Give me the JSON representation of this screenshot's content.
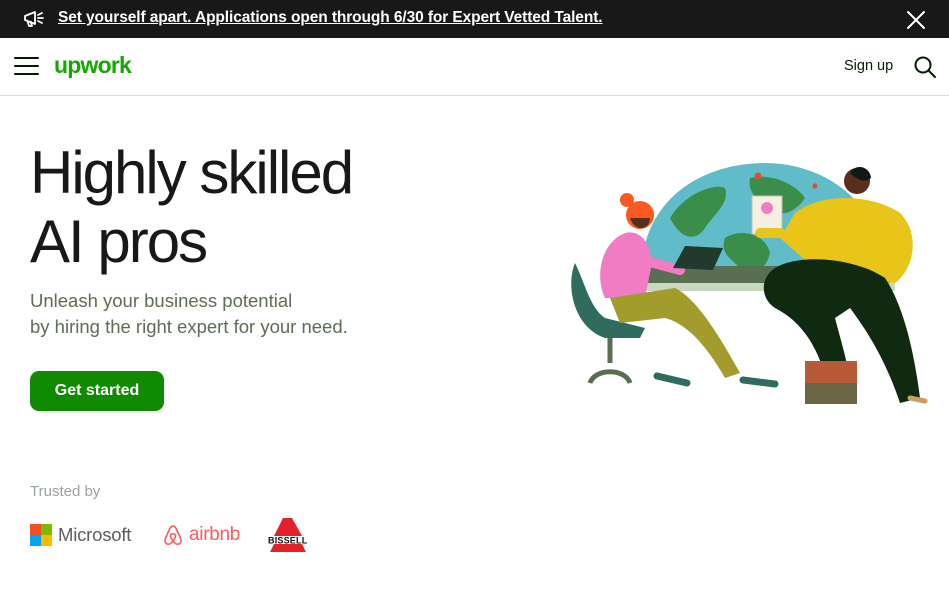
{
  "banner": {
    "text": "Set yourself apart. Applications open through 6/30 for Expert Vetted Talent.",
    "icon": "megaphone-icon",
    "close_icon": "close-icon"
  },
  "nav": {
    "logo_text": "upwork",
    "signup_label": "Sign up",
    "menu_icon": "hamburger-menu-icon",
    "search_icon": "search-icon"
  },
  "hero": {
    "title_line1": "Highly skilled",
    "title_line2": "AI pros",
    "subtitle_line1": "Unleash your business potential",
    "subtitle_line2": "by hiring the right expert for your need.",
    "cta_label": "Get started"
  },
  "trusted": {
    "label": "Trusted by",
    "logos": [
      "Microsoft",
      "airbnb",
      "BISSELL"
    ]
  },
  "colors": {
    "brand_green": "#14a800",
    "cta_green": "#108a00",
    "banner_bg": "#181818",
    "text_dark": "#181818",
    "text_muted": "#5e6d55"
  }
}
